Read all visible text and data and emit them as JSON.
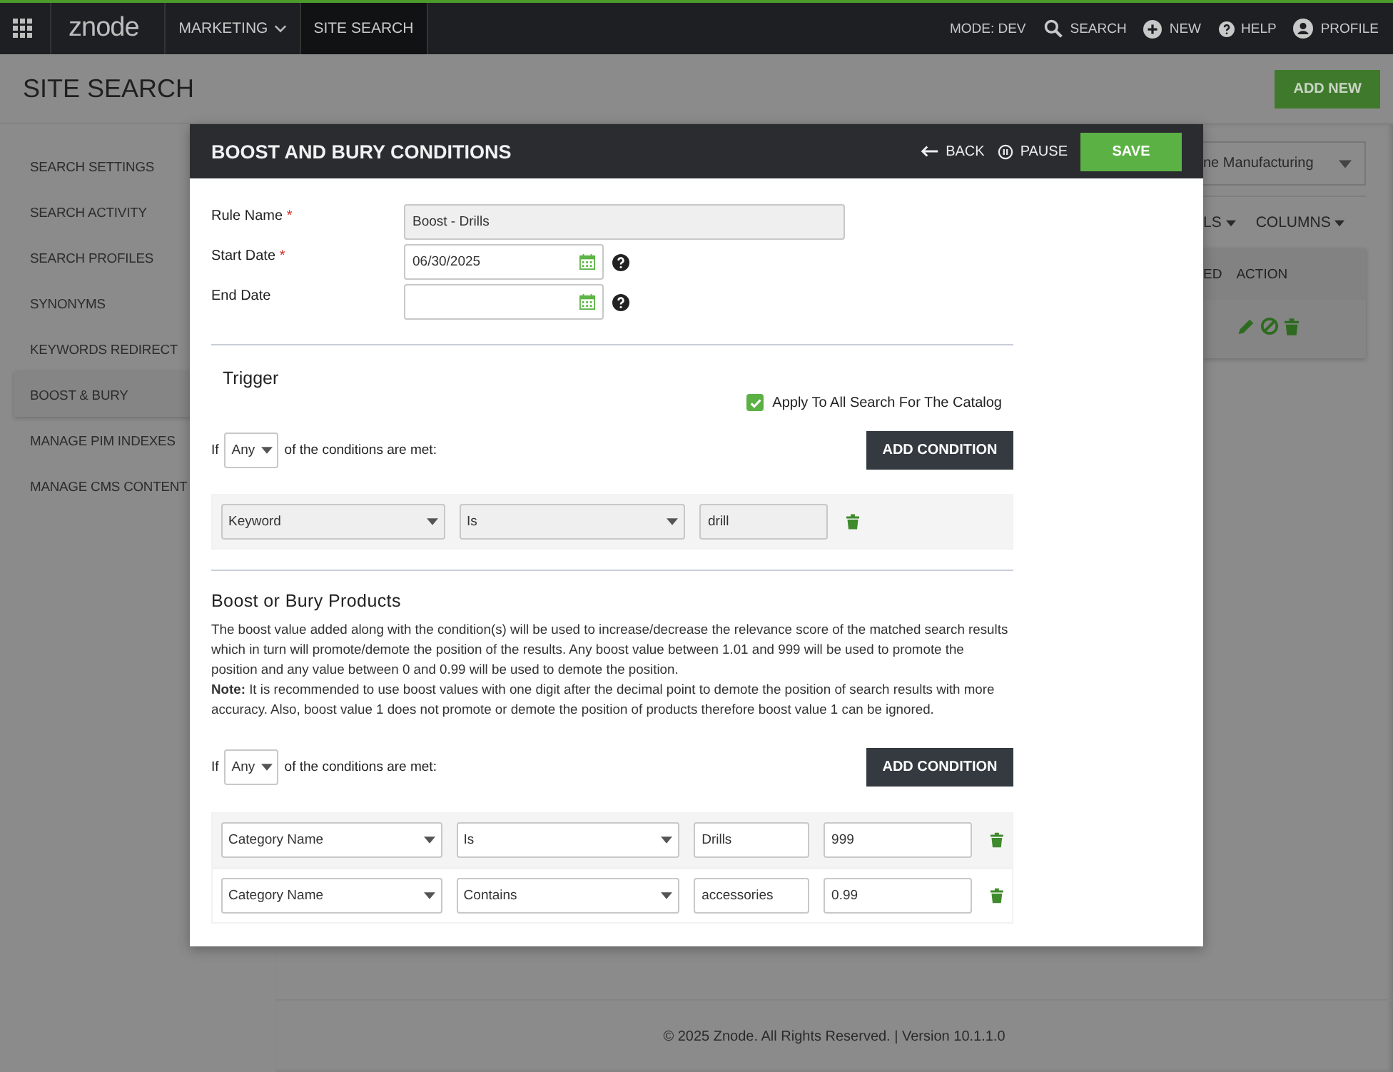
{
  "top_nav": {
    "logo": "znode",
    "menu_items": [
      {
        "label": "MARKETING",
        "selected": false,
        "has_caret": true
      },
      {
        "label": "SITE SEARCH",
        "selected": true,
        "has_caret": false
      }
    ],
    "actions": [
      {
        "kind": "text",
        "label": "MODE: DEV"
      },
      {
        "kind": "search",
        "label": "SEARCH"
      },
      {
        "kind": "new",
        "label": "NEW"
      },
      {
        "kind": "help",
        "label": "HELP"
      },
      {
        "kind": "profile",
        "label": "PROFILE"
      }
    ]
  },
  "page_header": {
    "title": "SITE SEARCH",
    "add_button": "ADD NEW"
  },
  "sidebar": {
    "items": [
      {
        "label": "SEARCH SETTINGS",
        "selected": false
      },
      {
        "label": "SEARCH ACTIVITY",
        "selected": false
      },
      {
        "label": "SEARCH PROFILES",
        "selected": false
      },
      {
        "label": "SYNONYMS",
        "selected": false
      },
      {
        "label": "KEYWORDS REDIRECT",
        "selected": false
      },
      {
        "label": "BOOST & BURY",
        "selected": true
      },
      {
        "label": "MANAGE PIM INDEXES",
        "selected": false
      },
      {
        "label": "MANAGE CMS CONTENT",
        "selected": false
      }
    ]
  },
  "background_panel": {
    "catalog_select": "ne Manufacturing",
    "toolbar": [
      "LS",
      "COLUMNS"
    ],
    "table": {
      "columns": [
        "ED",
        "ACTION"
      ]
    }
  },
  "modal": {
    "title": "BOOST AND BURY CONDITIONS",
    "back": "BACK",
    "pause": "PAUSE",
    "save": "SAVE",
    "fields": [
      {
        "kind": "text",
        "label": "Rule Name",
        "required_mark": "*",
        "value": "Boost - Drills"
      },
      {
        "kind": "date",
        "label": "Start Date",
        "required_mark": "*",
        "value": "06/30/2025"
      },
      {
        "kind": "date",
        "label": "End Date"
      }
    ],
    "trigger": {
      "heading": "Trigger",
      "apply_all": {
        "label": "Apply To All Search For The Catalog",
        "checked": true
      },
      "match": {
        "prefix": "If",
        "value": "Any",
        "suffix": "of the conditions are met:"
      },
      "add_button": "ADD CONDITION",
      "conditions": [
        {
          "field": "Keyword",
          "operator": "Is",
          "value": "drill"
        }
      ]
    },
    "boost": {
      "heading": "Boost or Bury Products",
      "description": [
        "The boost value added along with the condition(s) will be used to increase/decrease the relevance score of the matched search results which in turn will promote/demote the position of the results. Any boost value between 1.01 and 999 will be used to promote the position and any value between 0 and 0.99 will be used to demote the position.",
        "**Note:** It is recommended to use boost values with one digit after the decimal point to demote the position of search results with more accuracy. Also, boost value 1 does not promote or demote the position of products therefore boost value 1 can be ignored."
      ],
      "match": {
        "prefix": "If",
        "value": "Any",
        "suffix": "of the conditions are met:"
      },
      "add_button": "ADD CONDITION",
      "conditions": [
        {
          "field": "Category Name",
          "operator": "Is",
          "value": "Drills",
          "boost": "999"
        },
        {
          "field": "Category Name",
          "operator": "Contains",
          "value": "accessories",
          "boost": "0.99"
        }
      ]
    }
  },
  "footer": "© 2025 Znode. All Rights Reserved. | Version 10.1.1.0"
}
